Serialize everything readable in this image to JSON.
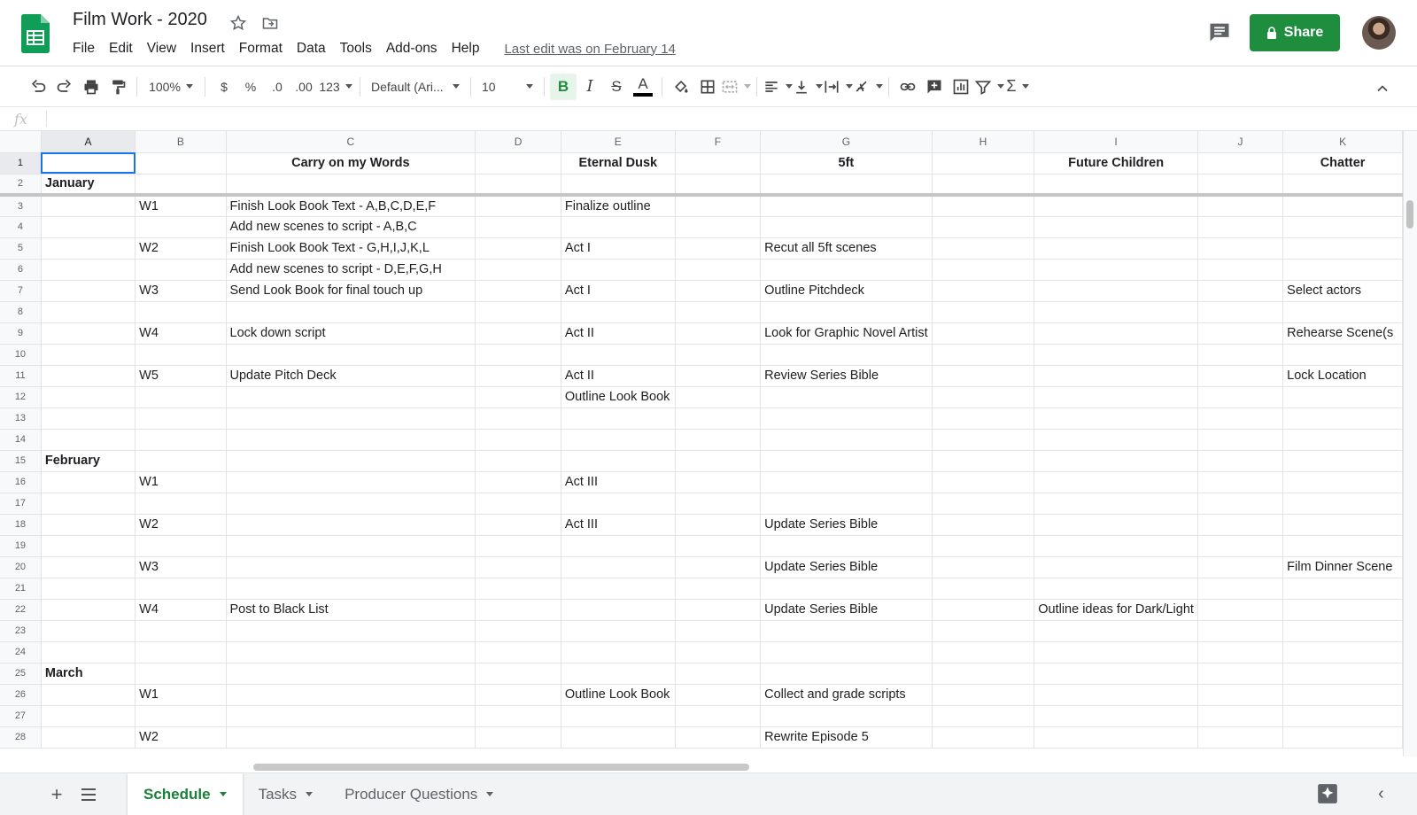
{
  "header": {
    "title": "Film Work - 2020",
    "menu": [
      "File",
      "Edit",
      "View",
      "Insert",
      "Format",
      "Data",
      "Tools",
      "Add-ons",
      "Help"
    ],
    "last_edit": "Last edit was on February 14",
    "share_label": "Share",
    "brand_color": "#1e8e3e"
  },
  "toolbar": {
    "zoom": "100%",
    "currency": "$",
    "percent": "%",
    "dec_decrease": ".0",
    "dec_increase": ".00",
    "more_formats": "123",
    "font": "Default (Ari...",
    "font_size": "10",
    "bold": "B",
    "italic": "I",
    "strike": "S",
    "text_color": "A",
    "sum": "Σ"
  },
  "formula_bar": {
    "fx": "fx",
    "value": ""
  },
  "columns": [
    "A",
    "B",
    "C",
    "D",
    "E",
    "F",
    "G",
    "H",
    "I",
    "J",
    "K"
  ],
  "rows": [
    {
      "n": "1",
      "cells": [
        "",
        "",
        "Carry on my Words",
        "",
        "Eternal Dusk",
        "",
        "5ft",
        "",
        "Future Children",
        "",
        "Chatter"
      ]
    },
    {
      "n": "2",
      "cells": [
        "January",
        "",
        "",
        "",
        "",
        "",
        "",
        "",
        "",
        "",
        ""
      ]
    },
    {
      "n": "3",
      "cells": [
        "",
        "W1",
        "Finish Look Book Text - A,B,C,D,E,F",
        "",
        "Finalize outline",
        "",
        "",
        "",
        "",
        "",
        ""
      ]
    },
    {
      "n": "4",
      "cells": [
        "",
        "",
        "Add new scenes to script - A,B,C",
        "",
        "",
        "",
        "",
        "",
        "",
        "",
        ""
      ]
    },
    {
      "n": "5",
      "cells": [
        "",
        "W2",
        "Finish Look Book Text - G,H,I,J,K,L",
        "",
        "Act I",
        "",
        "Recut all 5ft scenes",
        "",
        "",
        "",
        ""
      ]
    },
    {
      "n": "6",
      "cells": [
        "",
        "",
        "Add new scenes to script - D,E,F,G,H",
        "",
        "",
        "",
        "",
        "",
        "",
        "",
        ""
      ]
    },
    {
      "n": "7",
      "cells": [
        "",
        "W3",
        "Send Look Book for final touch up",
        "",
        "Act I",
        "",
        "Outline Pitchdeck",
        "",
        "",
        "",
        "Select actors"
      ]
    },
    {
      "n": "8",
      "cells": [
        "",
        "",
        "",
        "",
        "",
        "",
        "",
        "",
        "",
        "",
        ""
      ]
    },
    {
      "n": "9",
      "cells": [
        "",
        "W4",
        "Lock down script",
        "",
        "Act II",
        "",
        "Look for Graphic Novel Artist",
        "",
        "",
        "",
        "Rehearse Scene(s"
      ]
    },
    {
      "n": "10",
      "cells": [
        "",
        "",
        "",
        "",
        "",
        "",
        "",
        "",
        "",
        "",
        ""
      ]
    },
    {
      "n": "11",
      "cells": [
        "",
        "W5",
        "Update Pitch Deck",
        "",
        "Act II",
        "",
        "Review Series Bible",
        "",
        "",
        "",
        "Lock Location"
      ]
    },
    {
      "n": "12",
      "cells": [
        "",
        "",
        "",
        "",
        "Outline Look Book",
        "",
        "",
        "",
        "",
        "",
        ""
      ]
    },
    {
      "n": "13",
      "cells": [
        "",
        "",
        "",
        "",
        "",
        "",
        "",
        "",
        "",
        "",
        ""
      ]
    },
    {
      "n": "14",
      "cells": [
        "",
        "",
        "",
        "",
        "",
        "",
        "",
        "",
        "",
        "",
        ""
      ]
    },
    {
      "n": "15",
      "cells": [
        "February",
        "",
        "",
        "",
        "",
        "",
        "",
        "",
        "",
        "",
        ""
      ]
    },
    {
      "n": "16",
      "cells": [
        "",
        "W1",
        "",
        "",
        "Act III",
        "",
        "",
        "",
        "",
        "",
        ""
      ]
    },
    {
      "n": "17",
      "cells": [
        "",
        "",
        "",
        "",
        "",
        "",
        "",
        "",
        "",
        "",
        ""
      ]
    },
    {
      "n": "18",
      "cells": [
        "",
        "W2",
        "",
        "",
        "Act III",
        "",
        "Update Series Bible",
        "",
        "",
        "",
        ""
      ]
    },
    {
      "n": "19",
      "cells": [
        "",
        "",
        "",
        "",
        "",
        "",
        "",
        "",
        "",
        "",
        ""
      ]
    },
    {
      "n": "20",
      "cells": [
        "",
        "W3",
        "",
        "",
        "",
        "",
        "Update Series Bible",
        "",
        "",
        "",
        "Film Dinner Scene"
      ]
    },
    {
      "n": "21",
      "cells": [
        "",
        "",
        "",
        "",
        "",
        "",
        "",
        "",
        "",
        "",
        ""
      ]
    },
    {
      "n": "22",
      "cells": [
        "",
        "W4",
        "Post to Black List",
        "",
        "",
        "",
        "Update Series Bible",
        "",
        "Outline ideas for Dark/Light",
        "",
        ""
      ]
    },
    {
      "n": "23",
      "cells": [
        "",
        "",
        "",
        "",
        "",
        "",
        "",
        "",
        "",
        "",
        ""
      ]
    },
    {
      "n": "24",
      "cells": [
        "",
        "",
        "",
        "",
        "",
        "",
        "",
        "",
        "",
        "",
        ""
      ]
    },
    {
      "n": "25",
      "cells": [
        "March",
        "",
        "",
        "",
        "",
        "",
        "",
        "",
        "",
        "",
        ""
      ]
    },
    {
      "n": "26",
      "cells": [
        "",
        "W1",
        "",
        "",
        "Outline Look Book",
        "",
        "Collect and grade scripts",
        "",
        "",
        "",
        ""
      ]
    },
    {
      "n": "27",
      "cells": [
        "",
        "",
        "",
        "",
        "",
        "",
        "",
        "",
        "",
        "",
        ""
      ]
    },
    {
      "n": "28",
      "cells": [
        "",
        "W2",
        "",
        "",
        "",
        "",
        "Rewrite Episode 5",
        "",
        "",
        "",
        ""
      ]
    }
  ],
  "sheet_tabs": [
    "Schedule",
    "Tasks",
    "Producer Questions"
  ],
  "active_tab": "Schedule"
}
